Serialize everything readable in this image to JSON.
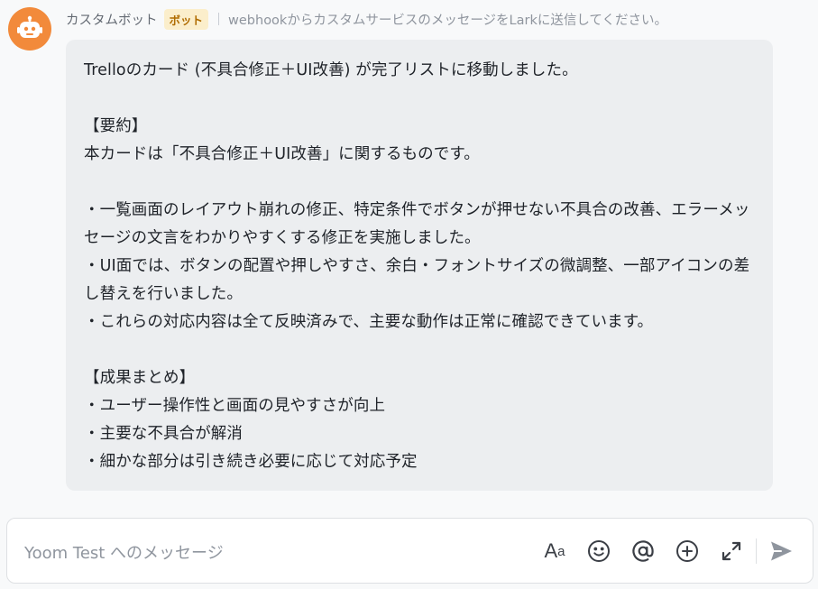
{
  "message": {
    "sender_name": "カスタムボット",
    "badge": "ボット",
    "bot_description": "webhookからカスタムサービスのメッセージをLarkに送信してください。",
    "body": "Trelloのカード (不具合修正＋UI改善) が完了リストに移動しました。\n\n【要約】\n本カードは「不具合修正＋UI改善」に関するものです。\n\n・一覧画面のレイアウト崩れの修正、特定条件でボタンが押せない不具合の改善、エラーメッセージの文言をわかりやすくする修正を実施しました。\n・UI面では、ボタンの配置や押しやすさ、余白・フォントサイズの微調整、一部アイコンの差し替えを行いました。\n・これらの対応内容は全て反映済みで、主要な動作は正常に確認できています。\n\n【成果まとめ】\n・ユーザー操作性と画面の見やすさが向上\n・主要な不具合が解消\n・細かな部分は引き続き必要に応じて対応予定"
  },
  "composer": {
    "placeholder": "Yoom Test へのメッセージ",
    "font_tool_big": "A",
    "font_tool_small": "a",
    "icons": [
      "text-format-icon",
      "emoji-icon",
      "mention-icon",
      "add-icon",
      "expand-icon",
      "send-icon"
    ]
  },
  "colors": {
    "avatar": "#f28a3b",
    "badge_bg": "#fbeecb",
    "badge_text": "#b06c00",
    "bubble_bg": "#eceef0"
  }
}
